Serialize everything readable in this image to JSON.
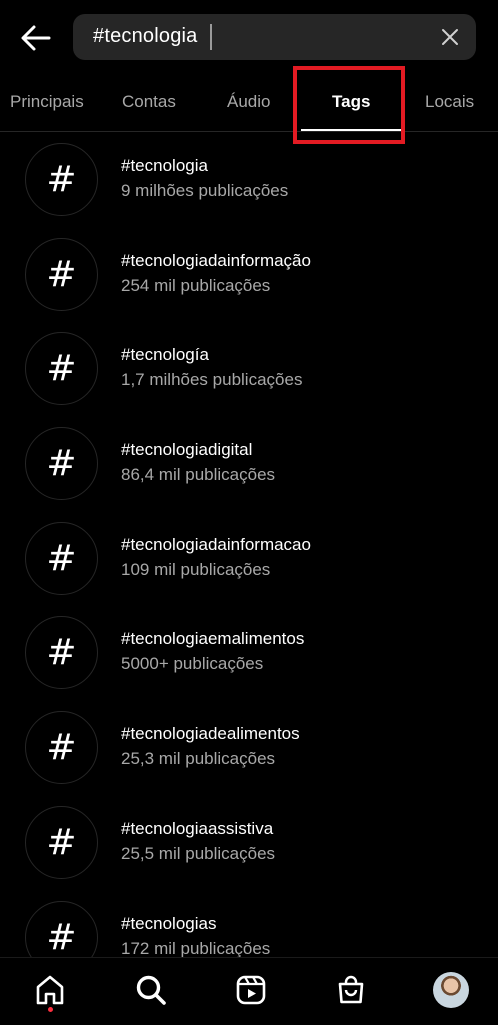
{
  "search": {
    "query": "#tecnologia"
  },
  "tabs": [
    {
      "label": "Principais"
    },
    {
      "label": "Contas"
    },
    {
      "label": "Áudio"
    },
    {
      "label": "Tags"
    },
    {
      "label": "Locais"
    }
  ],
  "active_tab": "Tags",
  "tag_icon": "#",
  "results": [
    {
      "name": "#tecnologia",
      "count": "9 milhões publicações"
    },
    {
      "name": "#tecnologiadainformação",
      "count": "254 mil publicações"
    },
    {
      "name": "#tecnología",
      "count": "1,7 milhões publicações"
    },
    {
      "name": "#tecnologiadigital",
      "count": "86,4 mil publicações"
    },
    {
      "name": "#tecnologiadainformacao",
      "count": "109 mil publicações"
    },
    {
      "name": "#tecnologiaemalimentos",
      "count": "5000+ publicações"
    },
    {
      "name": "#tecnologiadealimentos",
      "count": "25,3 mil publicações"
    },
    {
      "name": "#tecnologiaassistiva",
      "count": "25,5 mil publicações"
    },
    {
      "name": "#tecnologias",
      "count": "172 mil publicações"
    }
  ],
  "bottom_nav": [
    "home-icon",
    "search-icon",
    "reels-icon",
    "shop-icon",
    "profile-avatar"
  ],
  "colors": {
    "highlight": "#e31b23",
    "notification_dot": "#ff3040"
  }
}
